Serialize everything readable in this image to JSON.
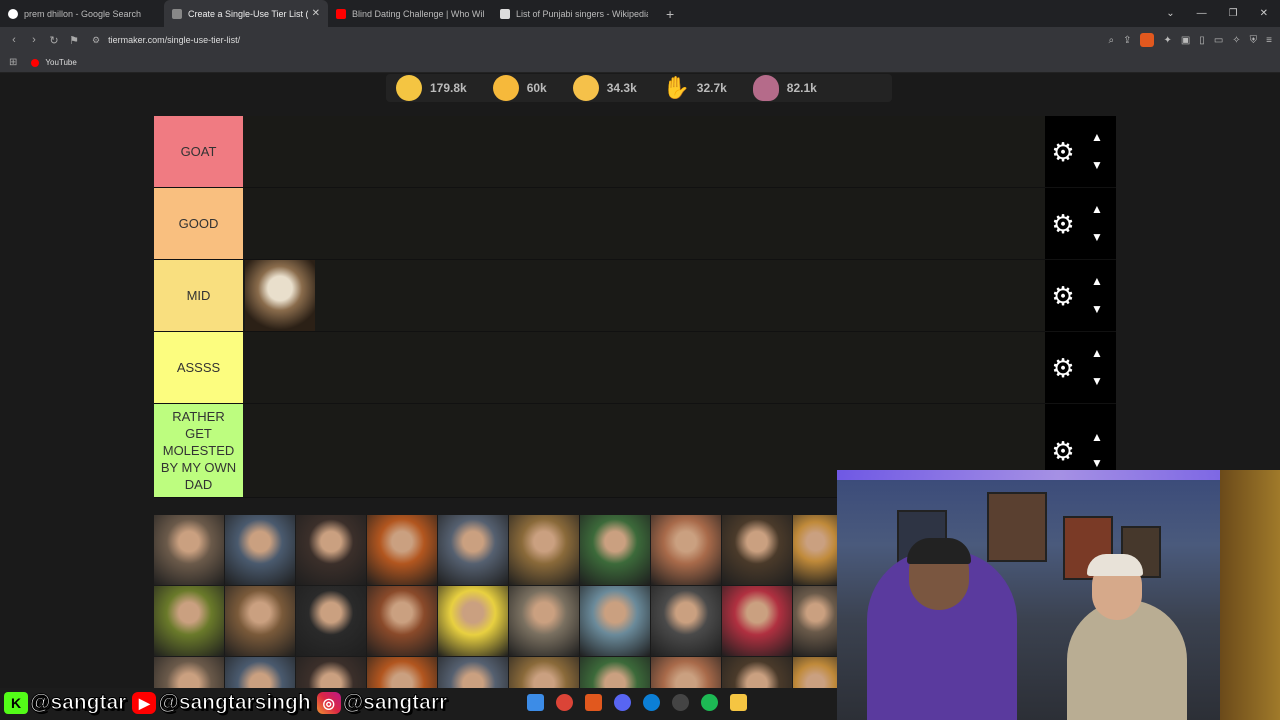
{
  "browser": {
    "tabs": [
      {
        "title": "prem dhillon - Google Search",
        "active": false
      },
      {
        "title": "Create a Single-Use Tier List (Pri",
        "active": true
      },
      {
        "title": "Blind Dating Challenge | Who Will Ki",
        "active": false
      },
      {
        "title": "List of Punjabi singers - Wikipedia",
        "active": false
      }
    ],
    "url": "tiermaker.com/single-use-tier-list/",
    "bookmark": "YouTube"
  },
  "reactions": [
    {
      "icon": "grinning-face-icon",
      "count": "179.8k"
    },
    {
      "icon": "heart-eyes-face-icon",
      "count": "60k"
    },
    {
      "icon": "laughing-face-icon",
      "count": "34.3k"
    },
    {
      "icon": "raised-hands-icon",
      "count": "32.7k"
    },
    {
      "icon": "poop-icon",
      "count": "82.1k"
    }
  ],
  "tiers": [
    {
      "label": "GOAT",
      "color": "#f07b82"
    },
    {
      "label": "GOOD",
      "color": "#f9bf7f"
    },
    {
      "label": "MID",
      "color": "#f9df7f"
    },
    {
      "label": "ASSSS",
      "color": "#fcfd7f"
    },
    {
      "label": "RATHER GET MOLESTED BY MY OWN DAD",
      "color": "#bdfd7f"
    }
  ],
  "overlay": {
    "kick": "@sangtar",
    "youtube": "@sangtarsingh",
    "instagram": "@sangtarr"
  }
}
